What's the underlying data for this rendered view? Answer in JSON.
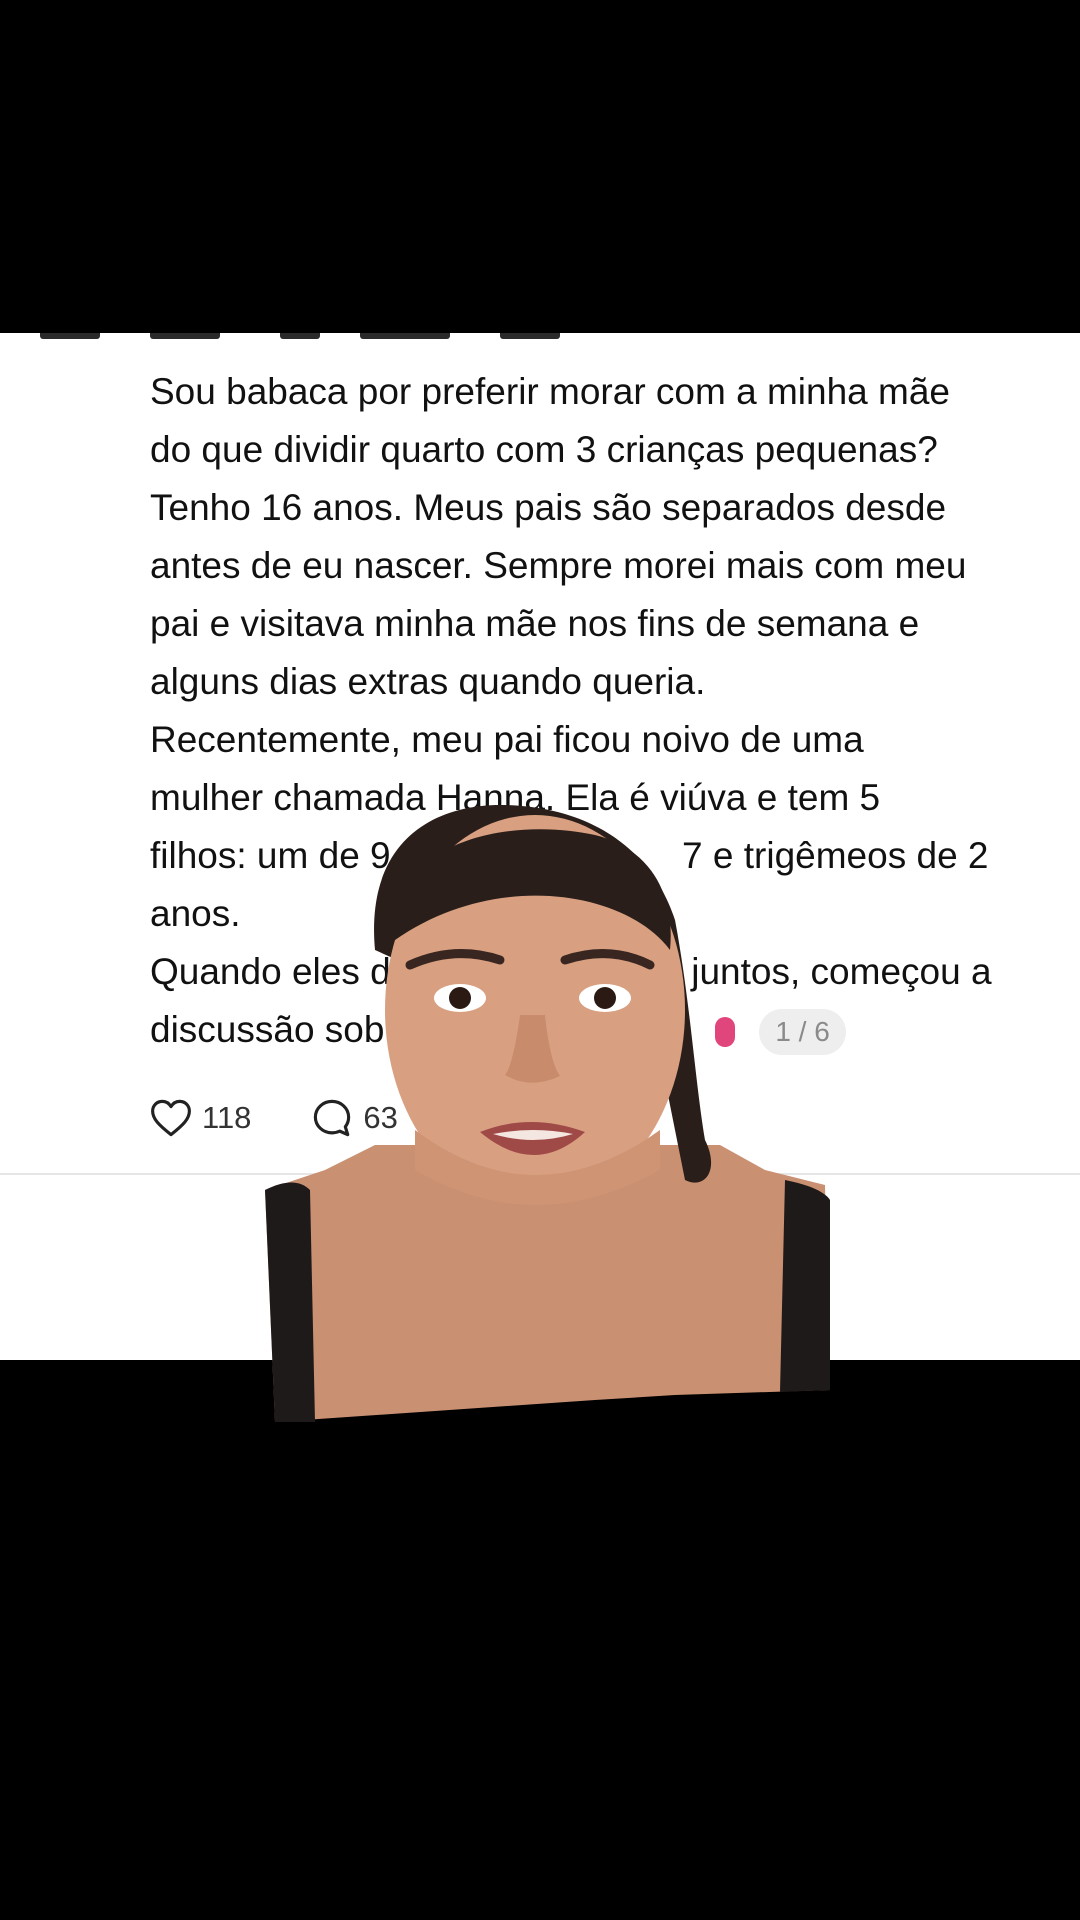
{
  "post": {
    "lines": [
      "Sou babaca por preferir morar com a minha mãe",
      "do que dividir quarto com 3 crianças pequenas?",
      "Tenho 16 anos. Meus pais são separados desde",
      "antes de eu nascer. Sempre morei mais com meu",
      "pai e visitava minha mãe nos fins de semana e",
      "alguns dias extras quando queria.",
      "Recentemente, meu pai ficou noivo de uma",
      "mulher chamada Hanna. Ela é viúva e tem 5",
      "filhos: um de 9 a",
      "7 e trigêmeos de 2",
      "anos.",
      "Quando eles d",
      "juntos, começou a",
      "discussão sob"
    ],
    "page_indicator": "1 / 6"
  },
  "actions": {
    "likes": "118",
    "comments": "63"
  },
  "icons": {
    "like": "heart-icon",
    "comment": "comment-bubble-icon"
  },
  "colors": {
    "background": "#000000",
    "card": "#ffffff",
    "text": "#111111",
    "badge_bg": "#eeeeee",
    "badge_text": "#8a8a8a"
  }
}
